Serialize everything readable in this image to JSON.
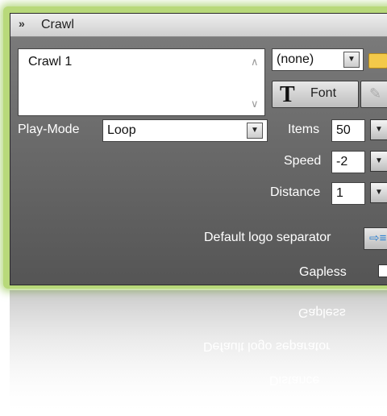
{
  "panel": {
    "title": "Crawl",
    "crawl_list": {
      "items": [
        "Crawl 1"
      ]
    },
    "logo_select": {
      "value": "(none)"
    },
    "font_button_label": "Font",
    "play_mode": {
      "label": "Play-Mode",
      "value": "Loop"
    },
    "items": {
      "label": "Items",
      "value": "50"
    },
    "speed": {
      "label": "Speed",
      "value": "-2"
    },
    "distance": {
      "label": "Distance",
      "value": "1"
    },
    "default_logo_separator": {
      "label": "Default logo separator"
    },
    "gapless": {
      "label": "Gapless",
      "checked": false
    }
  }
}
